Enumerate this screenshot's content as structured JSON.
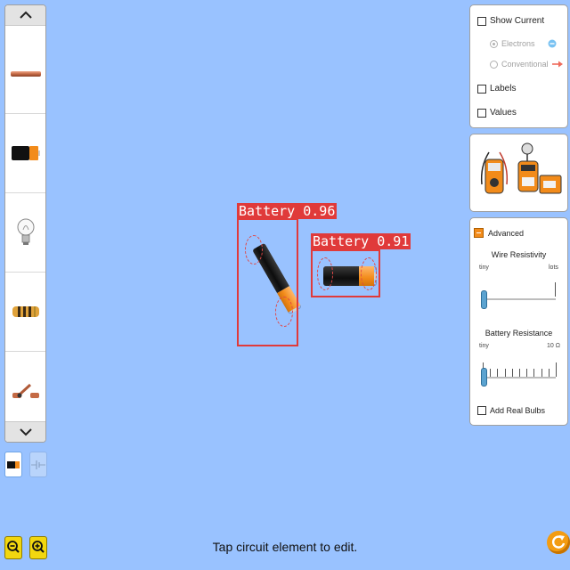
{
  "toolbox": {
    "items": [
      {
        "name": "wire"
      },
      {
        "name": "battery"
      },
      {
        "name": "light-bulb"
      },
      {
        "name": "resistor"
      },
      {
        "name": "switch"
      }
    ],
    "scroll_up_icon": "chevron-up-icon",
    "scroll_down_icon": "chevron-down-icon"
  },
  "view_toggles": [
    {
      "name": "lifelike-view",
      "selected": true
    },
    {
      "name": "schematic-view",
      "selected": false
    }
  ],
  "current_panel": {
    "show_current_label": "Show Current",
    "electrons_label": "Electrons",
    "conventional_label": "Conventional",
    "labels_label": "Labels",
    "values_label": "Values"
  },
  "advanced_panel": {
    "advanced_label": "Advanced",
    "wire_resistivity": {
      "title": "Wire Resistivity",
      "min_label": "tiny",
      "max_label": "lots",
      "value_fraction": 0.0
    },
    "battery_resistance": {
      "title": "Battery Resistance",
      "min_label": "tiny",
      "max_label": "10 Ω",
      "value_fraction": 0.0
    },
    "add_real_bulbs_label": "Add Real Bulbs"
  },
  "detections": [
    {
      "label": "Battery 0.96"
    },
    {
      "label": "Battery 0.91"
    }
  ],
  "status_text": "Tap circuit element to edit.",
  "colors": {
    "background": "#99c2ff",
    "detection": "#e03a3a",
    "accent_orange": "#f28b1a",
    "zoom_yellow": "#f2d70f"
  }
}
